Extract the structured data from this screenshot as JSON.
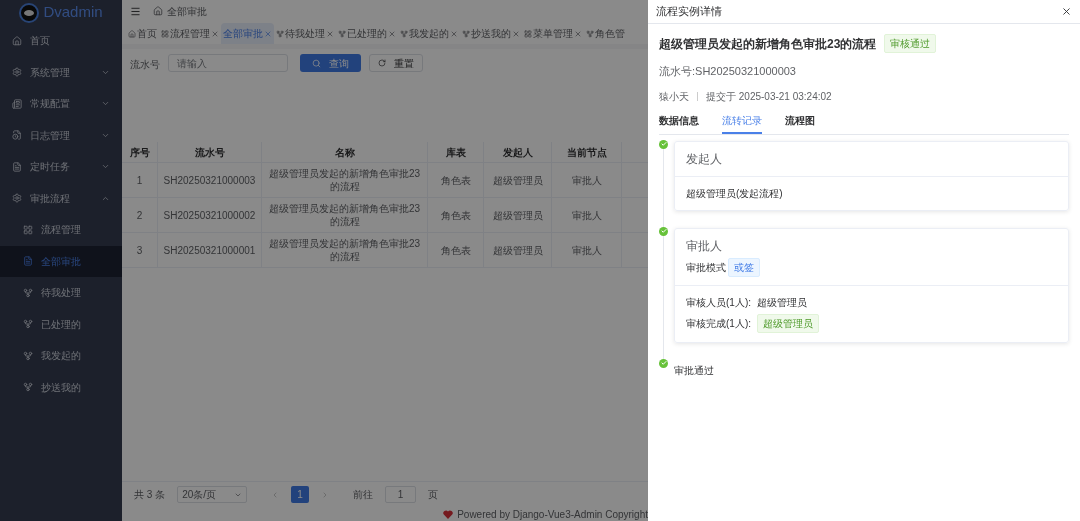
{
  "sidebar": {
    "logo_text": "Dvadmin",
    "items": [
      {
        "label": "首页",
        "kind": "home"
      },
      {
        "label": "系统管理",
        "kind": "gear",
        "expanded": false
      },
      {
        "label": "常规配置",
        "kind": "doc",
        "expanded": false
      },
      {
        "label": "日志管理",
        "kind": "log",
        "expanded": false
      },
      {
        "label": "定时任务",
        "kind": "task",
        "expanded": false
      },
      {
        "label": "审批流程",
        "kind": "gear",
        "expanded": true,
        "children": [
          {
            "label": "流程管理",
            "kind": "grid",
            "selected": false
          },
          {
            "label": "全部审批",
            "kind": "task",
            "selected": true
          },
          {
            "label": "待我处理",
            "kind": "branch",
            "selected": false
          },
          {
            "label": "已处理的",
            "kind": "branch",
            "selected": false
          },
          {
            "label": "我发起的",
            "kind": "branch",
            "selected": false
          },
          {
            "label": "抄送我的",
            "kind": "branch",
            "selected": false
          }
        ]
      }
    ]
  },
  "breadcrumb": "全部审批",
  "tabs": [
    {
      "label": "首页",
      "kind": "home",
      "closable": false,
      "selected": false
    },
    {
      "label": "流程管理",
      "kind": "grid",
      "closable": true,
      "selected": false
    },
    {
      "label": "全部审批",
      "kind": "plain",
      "closable": true,
      "selected": true
    },
    {
      "label": "待我处理",
      "kind": "branch",
      "closable": true,
      "selected": false
    },
    {
      "label": "已处理的",
      "kind": "branch",
      "closable": true,
      "selected": false
    },
    {
      "label": "我发起的",
      "kind": "branch",
      "closable": true,
      "selected": false
    },
    {
      "label": "抄送我的",
      "kind": "branch",
      "closable": true,
      "selected": false
    },
    {
      "label": "菜单管理",
      "kind": "grid",
      "closable": true,
      "selected": false
    },
    {
      "label": "角色管",
      "kind": "branch",
      "closable": false,
      "selected": false
    }
  ],
  "search": {
    "label": "流水号",
    "placeholder": "请输入",
    "query_button": "查询",
    "reset_button": "重置"
  },
  "table": {
    "columns": [
      "序号",
      "流水号",
      "名称",
      "库表",
      "发起人",
      "当前节点"
    ],
    "rows": [
      [
        "1",
        "SH20250321000003",
        "超级管理员发起的新增角色审批23的流程",
        "角色表",
        "超级管理员",
        "审批人"
      ],
      [
        "2",
        "SH20250321000002",
        "超级管理员发起的新增角色审批23的流程",
        "角色表",
        "超级管理员",
        "审批人"
      ],
      [
        "3",
        "SH20250321000001",
        "超级管理员发起的新增角色审批23的流程",
        "角色表",
        "超级管理员",
        "审批人"
      ]
    ]
  },
  "pagination": {
    "total": "共 3 条",
    "page_size": "20条/页",
    "pages": [
      {
        "label": "1",
        "selected": true
      }
    ],
    "goto_label": "前往",
    "goto_value": "1",
    "goto_suffix": "页"
  },
  "footer": "Powered by Django-Vue3-Admin Copyright",
  "drawer": {
    "title": "流程实例详情",
    "heading": "超级管理员发起的新增角色审批23的流程",
    "status": "审核通过",
    "serial": "流水号:SH20250321000003",
    "user": "猿小天",
    "submitted": "提交于 2025-03-21 03:24:02",
    "tabs": [
      {
        "label": "数据信息",
        "selected": false
      },
      {
        "label": "流转记录",
        "selected": true
      },
      {
        "label": "流程图",
        "selected": false
      }
    ],
    "timeline": [
      {
        "kind": "card",
        "title": "发起人",
        "body": [
          {
            "kind": "plain",
            "label": "超级管理员(发起流程)"
          }
        ]
      },
      {
        "kind": "card",
        "title": "审批人",
        "mode_label": "审批模式",
        "mode_tag": "或签",
        "body": [
          {
            "kind": "text",
            "label": "审核人员(1人):",
            "value": "超级管理员"
          },
          {
            "kind": "tag",
            "label": "审核完成(1人):",
            "value": "超级管理员"
          }
        ]
      },
      {
        "kind": "text",
        "title": "审批通过"
      }
    ]
  }
}
